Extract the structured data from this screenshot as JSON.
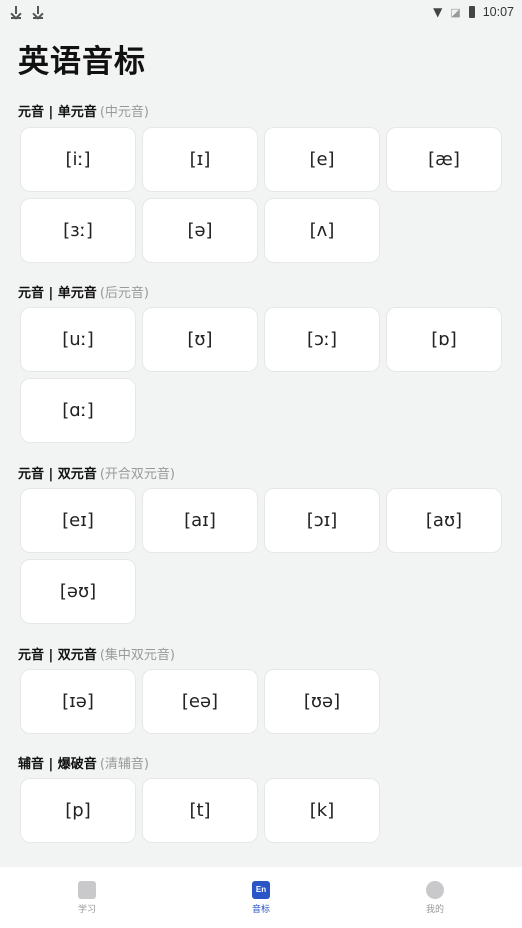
{
  "status": {
    "time": "10:07"
  },
  "page_title": "英语音标",
  "sections": [
    {
      "title": "元音 | 单元音",
      "subtitle": "(中元音)",
      "items": [
        "[iː]",
        "[ɪ]",
        "[e]",
        "[æ]",
        "[ɜː]",
        "[ə]",
        "[ʌ]"
      ]
    },
    {
      "title": "元音 | 单元音",
      "subtitle": "(后元音)",
      "items": [
        "[uː]",
        "[ʊ]",
        "[ɔː]",
        "[ɒ]",
        "[ɑː]"
      ]
    },
    {
      "title": "元音 | 双元音",
      "subtitle": "(开合双元音)",
      "items": [
        "[eɪ]",
        "[aɪ]",
        "[ɔɪ]",
        "[aʊ]",
        "[əʊ]"
      ]
    },
    {
      "title": "元音 | 双元音",
      "subtitle": "(集中双元音)",
      "items": [
        "[ɪə]",
        "[eə]",
        "[ʊə]"
      ]
    },
    {
      "title": "辅音 | 爆破音",
      "subtitle": "(清辅音)",
      "items": [
        "[p]",
        "[t]",
        "[k]"
      ]
    }
  ],
  "tabs": [
    {
      "label": "学习",
      "icon": "book-icon"
    },
    {
      "label": "音标",
      "icon": "en-icon",
      "icon_text": "En",
      "active": true
    },
    {
      "label": "我的",
      "icon": "profile-icon"
    }
  ],
  "colors": {
    "accent": "#2a55c6",
    "background": "#f2f4f3",
    "card": "#ffffff"
  }
}
